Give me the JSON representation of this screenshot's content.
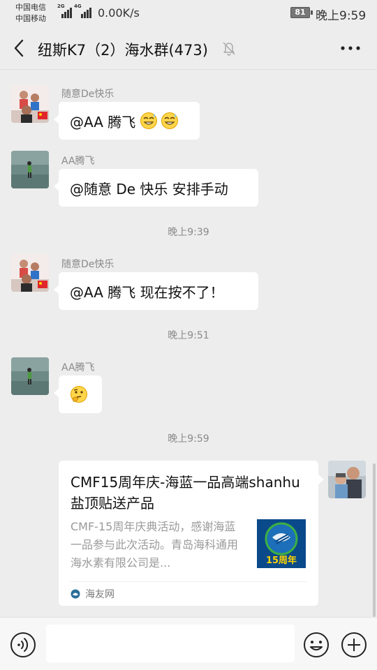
{
  "status_bar": {
    "carrier1": "中国电信",
    "carrier2": "中国移动",
    "net1": "2G",
    "net2": "4G",
    "speed": "0.00K/s",
    "battery": "81",
    "time": "晚上9:59"
  },
  "header": {
    "title": "纽斯K7（2）海水群(473)",
    "back_icon": "chevron-left-icon",
    "mute_icon": "bell-off-icon",
    "more_icon": "more-dots-icon"
  },
  "messages": [
    {
      "sender": "随意De快乐",
      "text": "@AA 腾飞 ",
      "emoji": [
        "grin-sweat-emoji",
        "grin-sweat-emoji"
      ]
    },
    {
      "sender": "AA腾飞",
      "text": "@随意 De 快乐  安排手动"
    },
    {
      "time": "晚上9:39"
    },
    {
      "sender": "随意De快乐",
      "text": "@AA 腾飞  现在按不了！"
    },
    {
      "time": "晚上9:51"
    },
    {
      "sender": "AA腾飞",
      "emoji": [
        "thinking-emoji"
      ]
    },
    {
      "time": "晚上9:59"
    }
  ],
  "time_labels": [
    "晚上9:39",
    "晚上9:51",
    "晚上9:59"
  ],
  "link_card": {
    "title": "CMF15周年庆-海蓝一品高端shanhu盐顶贴送产品",
    "description": "CMF-15周年庆典活动，感谢海蓝一品参与此次活动。青岛海科通用海水素有限公司是...",
    "thumb_label": "15周年",
    "source": "海友网"
  },
  "input_bar": {
    "placeholder": "",
    "voice_icon": "voice-icon",
    "emoji_icon": "smiley-icon",
    "plus_icon": "plus-circle-icon"
  },
  "colors": {
    "background": "#ededed",
    "bubble": "#ffffff",
    "thumb_blue": "#0a4a8a"
  }
}
